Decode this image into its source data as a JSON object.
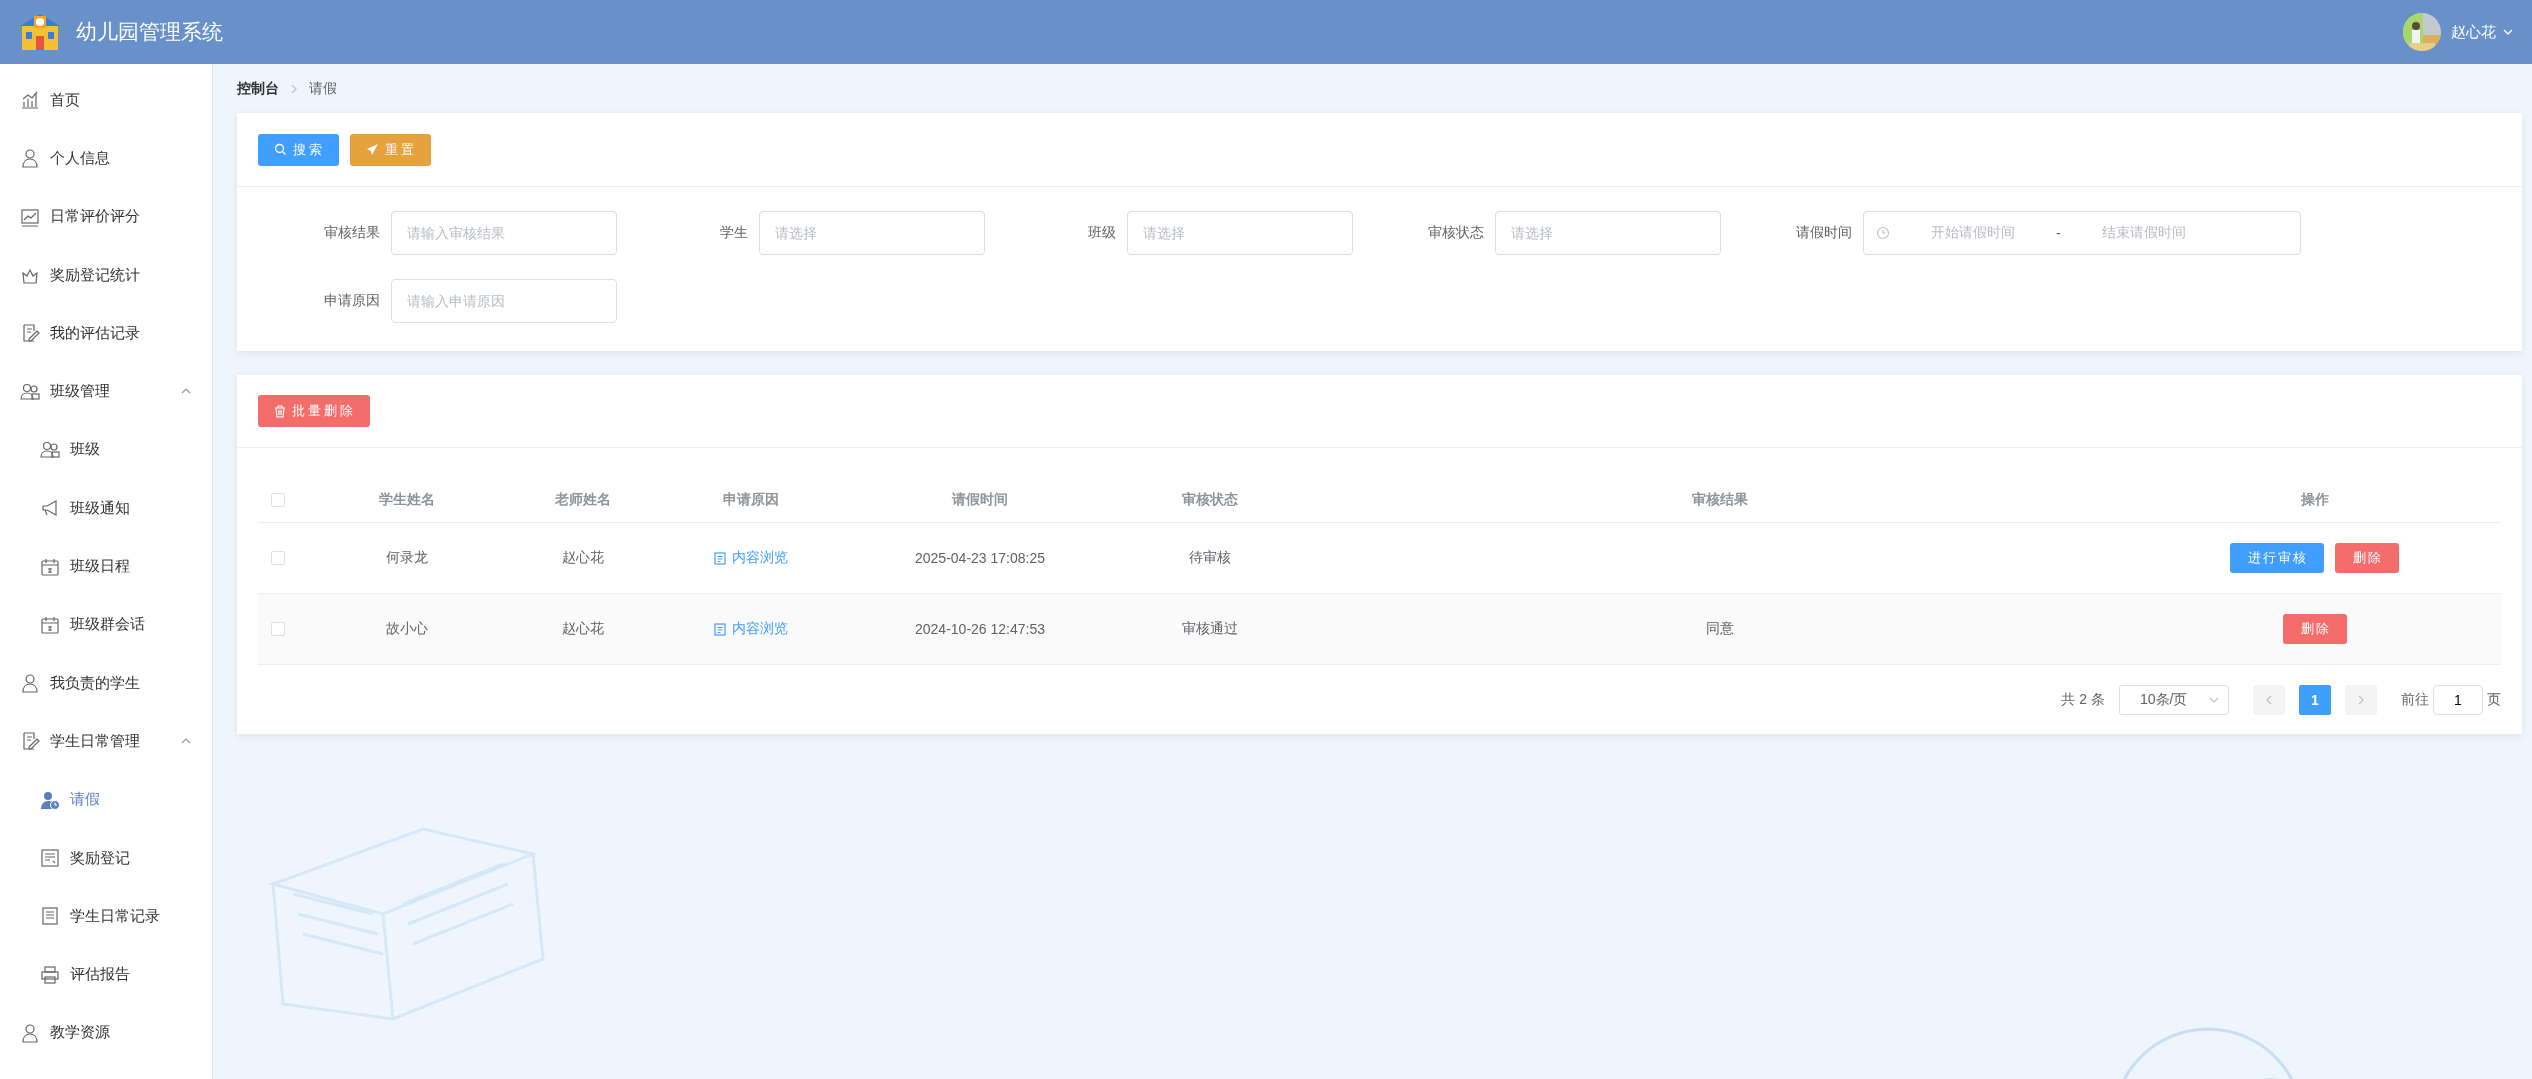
{
  "header": {
    "title": "幼儿园管理系统",
    "user": "赵心花"
  },
  "sidebar": {
    "items": [
      {
        "label": "首页",
        "selected": false
      },
      {
        "label": "个人信息",
        "selected": false
      },
      {
        "label": "日常评价评分",
        "selected": false
      },
      {
        "label": "奖励登记统计",
        "selected": false
      },
      {
        "label": "我的评估记录",
        "selected": false
      },
      {
        "label": "班级管理",
        "selected": false,
        "expanded": true,
        "children": [
          {
            "label": "班级",
            "selected": false
          },
          {
            "label": "班级通知",
            "selected": false
          },
          {
            "label": "班级日程",
            "selected": false
          },
          {
            "label": "班级群会话",
            "selected": false
          }
        ]
      },
      {
        "label": "我负责的学生",
        "selected": false
      },
      {
        "label": "学生日常管理",
        "selected": false,
        "expanded": true,
        "children": [
          {
            "label": "请假",
            "selected": true
          },
          {
            "label": "奖励登记",
            "selected": false
          },
          {
            "label": "学生日常记录",
            "selected": false
          },
          {
            "label": "评估报告",
            "selected": false
          }
        ]
      },
      {
        "label": "教学资源",
        "selected": false
      }
    ]
  },
  "breadcrumb": [
    "控制台",
    "请假"
  ],
  "search_panel": {
    "buttons": [
      {
        "label": "搜索",
        "kind": "search"
      },
      {
        "label": "重置",
        "kind": "reset"
      }
    ],
    "filters": [
      {
        "label": "审核结果",
        "kind": "input",
        "placeholder": "请输入审核结果"
      },
      {
        "label": "学生",
        "kind": "input",
        "placeholder": "请选择"
      },
      {
        "label": "班级",
        "kind": "input",
        "placeholder": "请选择"
      },
      {
        "label": "审核状态",
        "kind": "input",
        "placeholder": "请选择"
      },
      {
        "label": "请假时间",
        "kind": "daterange",
        "start_placeholder": "开始请假时间",
        "separator": "-",
        "end_placeholder": "结束请假时间"
      },
      {
        "label": "申请原因",
        "kind": "input",
        "placeholder": "请输入申请原因"
      }
    ]
  },
  "table": {
    "batch_delete": "批量删除",
    "all_checked": false,
    "columns": [
      "学生姓名",
      "老师姓名",
      "申请原因",
      "请假时间",
      "审核状态",
      "审核结果",
      "操作"
    ],
    "rows": [
      {
        "checked": false,
        "student": "何录龙",
        "teacher": "赵心花",
        "reason": "内容浏览",
        "time": "2025-04-23 17:08:25",
        "status": "待审核",
        "actions": [
          {
            "label": "进行审核",
            "kind": "review"
          },
          {
            "label": "删除",
            "kind": "delete"
          }
        ]
      },
      {
        "checked": false,
        "student": "故小心",
        "teacher": "赵心花",
        "reason": "内容浏览",
        "time": "2024-10-26 12:47:53",
        "status": "审核通过",
        "result": "同意",
        "actions": [
          {
            "label": "删除",
            "kind": "delete"
          }
        ]
      }
    ]
  },
  "pagination": {
    "total": "共 2 条",
    "page_size": "10条/页",
    "prev_disabled": true,
    "pages": [
      {
        "label": "1",
        "selected": true
      }
    ],
    "next_disabled": true,
    "goto_label": "前往",
    "goto_value": "1",
    "goto_suffix": "页"
  }
}
